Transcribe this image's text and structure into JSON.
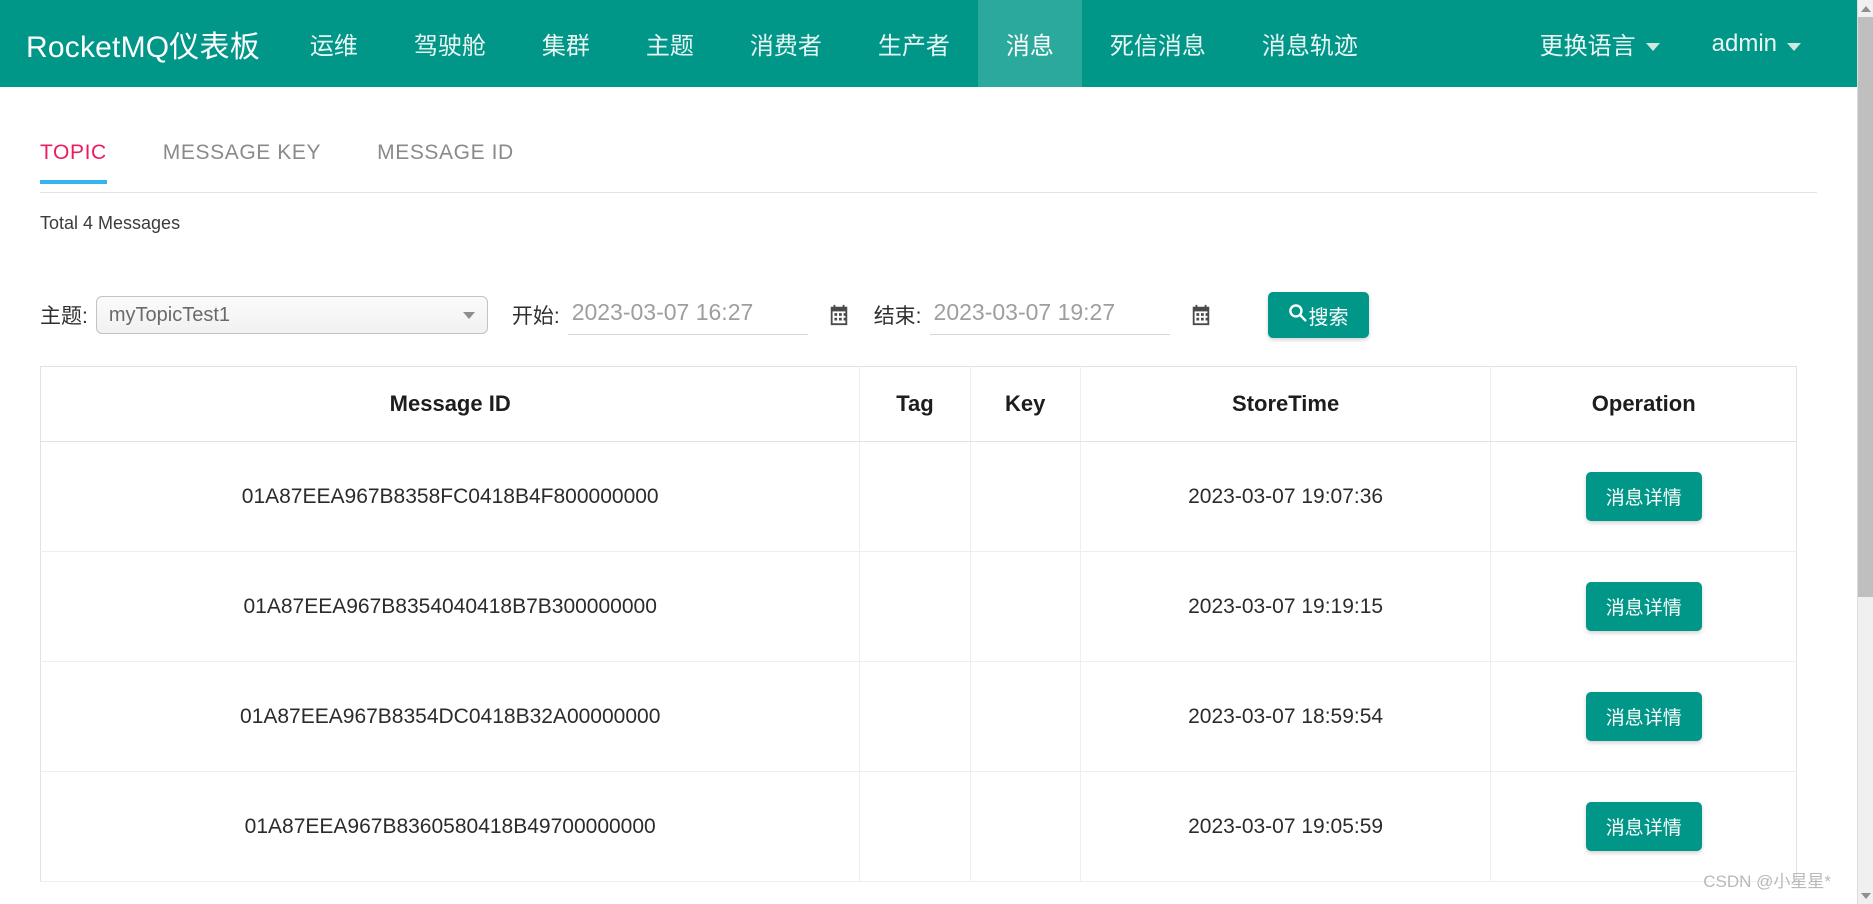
{
  "theme": {
    "primary": "#009688",
    "active_nav_bg": "#2aa99c",
    "tab_active_text": "#ec1c5e",
    "tab_active_underline": "#35b5ef"
  },
  "navbar": {
    "brand": "RocketMQ仪表板",
    "items": [
      {
        "label": "运维",
        "active": false
      },
      {
        "label": "驾驶舱",
        "active": false
      },
      {
        "label": "集群",
        "active": false
      },
      {
        "label": "主题",
        "active": false
      },
      {
        "label": "消费者",
        "active": false
      },
      {
        "label": "生产者",
        "active": false
      },
      {
        "label": "消息",
        "active": true
      },
      {
        "label": "死信消息",
        "active": false
      },
      {
        "label": "消息轨迹",
        "active": false
      }
    ],
    "language_label": "更换语言",
    "language_icon": "chevron-down-icon",
    "user_label": "admin",
    "user_icon": "chevron-down-icon"
  },
  "tabs": [
    {
      "label": "TOPIC",
      "active": true
    },
    {
      "label": "MESSAGE KEY",
      "active": false
    },
    {
      "label": "MESSAGE ID",
      "active": false
    }
  ],
  "summary": {
    "total_text": "Total 4 Messages"
  },
  "filters": {
    "topic_label": "主题:",
    "topic_value": "myTopicTest1",
    "topic_options": [
      "myTopicTest1"
    ],
    "begin_label": "开始:",
    "begin_placeholder": "2023-03-07 16:27",
    "begin_value": "",
    "begin_calendar_icon": "calendar-icon",
    "end_label": "结束:",
    "end_placeholder": "2023-03-07 19:27",
    "end_value": "",
    "end_calendar_icon": "calendar-icon",
    "search_label": "搜索",
    "search_icon": "search-icon"
  },
  "table": {
    "columns": [
      "Message ID",
      "Tag",
      "Key",
      "StoreTime",
      "Operation"
    ],
    "rows": [
      {
        "message_id": "01A87EEA967B8358FC0418B4F800000000",
        "tag": "",
        "key": "",
        "store_time": "2023-03-07 19:07:36",
        "action_label": "消息详情"
      },
      {
        "message_id": "01A87EEA967B8354040418B7B300000000",
        "tag": "",
        "key": "",
        "store_time": "2023-03-07 19:19:15",
        "action_label": "消息详情"
      },
      {
        "message_id": "01A87EEA967B8354DC0418B32A00000000",
        "tag": "",
        "key": "",
        "store_time": "2023-03-07 18:59:54",
        "action_label": "消息详情"
      },
      {
        "message_id": "01A87EEA967B8360580418B49700000000",
        "tag": "",
        "key": "",
        "store_time": "2023-03-07 19:05:59",
        "action_label": "消息详情"
      }
    ]
  },
  "watermark": {
    "text": "CSDN @小星星*"
  }
}
